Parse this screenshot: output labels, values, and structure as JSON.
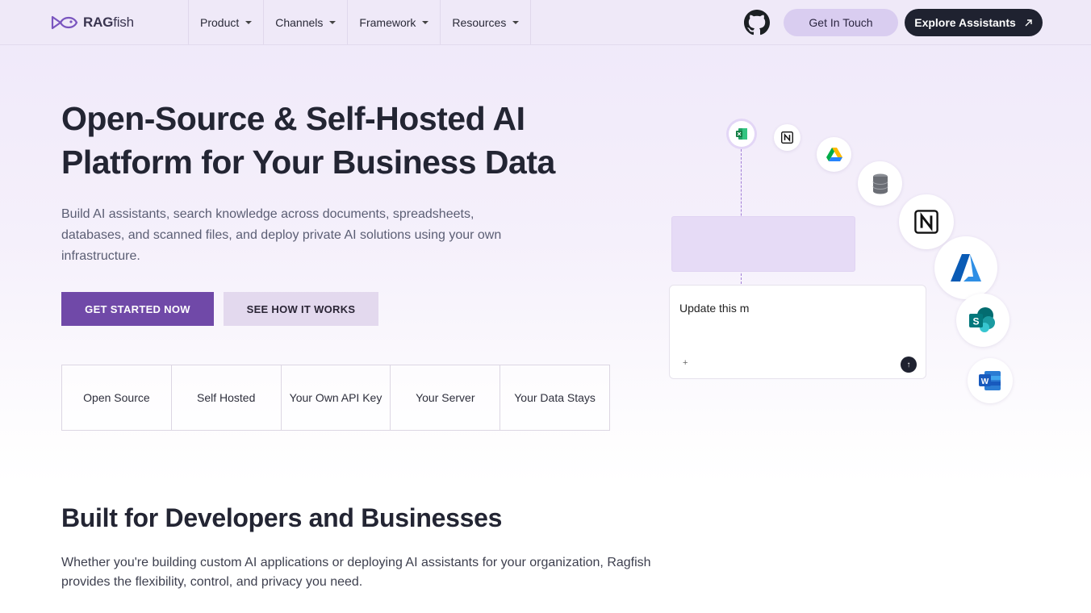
{
  "nav": {
    "logo_bold": "RAG",
    "logo_light": "fish",
    "menu": [
      {
        "label": "Product"
      },
      {
        "label": "Channels"
      },
      {
        "label": "Framework"
      },
      {
        "label": "Resources"
      }
    ],
    "github_icon": "github-icon",
    "get_in_touch": "Get In Touch",
    "explore": "Explore Assistants"
  },
  "hero": {
    "title": "Open-Source & Self-Hosted AI Platform for Your Business Data",
    "subtitle": "Build AI assistants, search knowledge across documents, spreadsheets, databases, and scanned files, and deploy private AI solutions using your own infrastructure.",
    "primary_cta": "GET STARTED NOW",
    "secondary_cta": "SEE HOW IT WORKS",
    "features": [
      "Open Source",
      "Self Hosted",
      "Your Own API Key",
      "Your Server",
      "Your Data Stays"
    ]
  },
  "illustration": {
    "chat_text": "Update this m",
    "plus": "+",
    "send": "↑",
    "icons": [
      "excel-icon",
      "notion-icon",
      "google-drive-icon",
      "database-icon",
      "notion-icon",
      "azure-icon",
      "sharepoint-icon",
      "word-icon"
    ]
  },
  "section": {
    "title": "Built for Developers and Businesses",
    "subtitle": "Whether you're building custom AI applications or deploying AI assistants for your organization, Ragfish provides the flexibility, control, and privacy you need."
  },
  "colors": {
    "primary": "#7049a8",
    "dark": "#1f2230",
    "lavender": "#d9cdf0"
  }
}
